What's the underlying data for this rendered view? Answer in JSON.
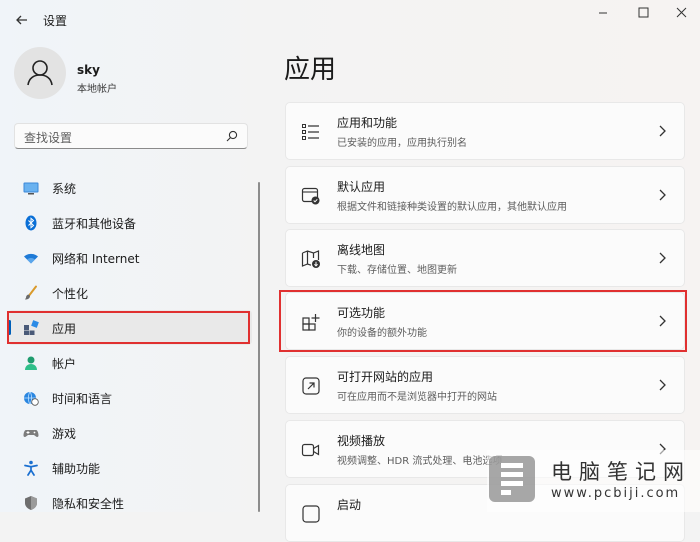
{
  "window": {
    "title": "设置"
  },
  "user": {
    "name": "sky",
    "account_type": "本地帐户"
  },
  "search": {
    "placeholder": "查找设置"
  },
  "sidebar": {
    "items": [
      {
        "label": "系统",
        "icon": "monitor-icon"
      },
      {
        "label": "蓝牙和其他设备",
        "icon": "bluetooth-icon"
      },
      {
        "label": "网络和 Internet",
        "icon": "wifi-icon"
      },
      {
        "label": "个性化",
        "icon": "brush-icon"
      },
      {
        "label": "应用",
        "icon": "apps-icon",
        "active": true
      },
      {
        "label": "帐户",
        "icon": "person-icon"
      },
      {
        "label": "时间和语言",
        "icon": "globe-clock-icon"
      },
      {
        "label": "游戏",
        "icon": "gamepad-icon"
      },
      {
        "label": "辅助功能",
        "icon": "accessibility-icon"
      },
      {
        "label": "隐私和安全性",
        "icon": "shield-icon"
      }
    ]
  },
  "main": {
    "title": "应用",
    "cards": [
      {
        "title": "应用和功能",
        "subtitle": "已安装的应用，应用执行别名",
        "icon": "list-icon"
      },
      {
        "title": "默认应用",
        "subtitle": "根据文件和链接种类设置的默认应用，其他默认应用",
        "icon": "default-app-icon"
      },
      {
        "title": "离线地图",
        "subtitle": "下载、存储位置、地图更新",
        "icon": "map-icon"
      },
      {
        "title": "可选功能",
        "subtitle": "你的设备的额外功能",
        "icon": "add-grid-icon"
      },
      {
        "title": "可打开网站的应用",
        "subtitle": "可在应用而不是浏览器中打开的网站",
        "icon": "open-external-icon"
      },
      {
        "title": "视频播放",
        "subtitle": "视频调整、HDR 流式处理、电池选项",
        "icon": "video-icon"
      },
      {
        "title": "启动",
        "subtitle": "",
        "icon": "startup-icon"
      }
    ]
  },
  "watermark": {
    "title": "电脑笔记网",
    "url": "www.pcbiji.com"
  },
  "colors": {
    "accent": "#005fb8",
    "highlight": "#e03030"
  }
}
